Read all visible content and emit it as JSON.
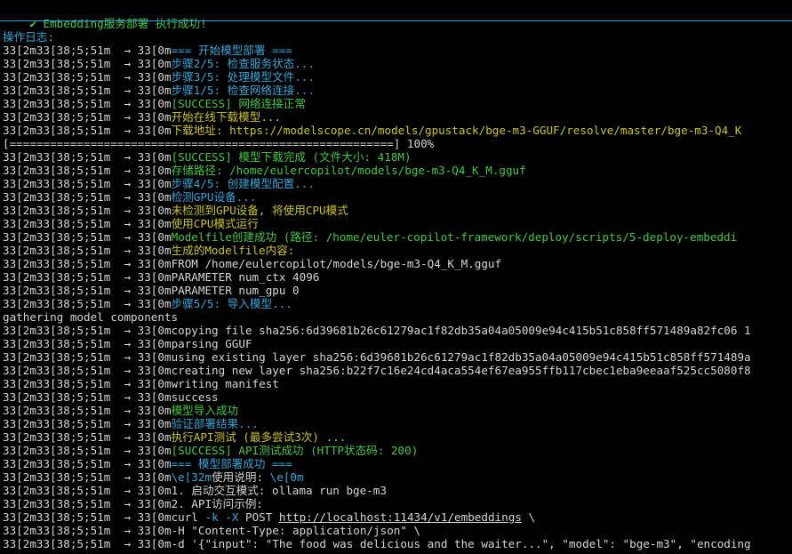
{
  "colors": {
    "background": "#000000",
    "default": "#d6d6d6",
    "cyan": "#3aa4d6",
    "green": "#45c645",
    "yellow": "#c9c432"
  },
  "title": {
    "check_icon": "✔",
    "text": " Embedding服务部署 执行成功!"
  },
  "lines": [
    {
      "segments": [
        {
          "t": "操作日志:",
          "c": "cyan"
        }
      ]
    },
    {
      "segments": [
        {
          "t": "33[2m33[38;5;51m  → 33[0m",
          "c": "default"
        },
        {
          "t": "=== 开始模型部署 ===",
          "c": "cyan"
        }
      ]
    },
    {
      "segments": [
        {
          "t": "33[2m33[38;5;51m  → 33[0m",
          "c": "default"
        },
        {
          "t": "步骤2/5: 检查服务状态...",
          "c": "cyan"
        }
      ]
    },
    {
      "segments": [
        {
          "t": "33[2m33[38;5;51m  → 33[0m",
          "c": "default"
        },
        {
          "t": "步骤3/5: 处理模型文件...",
          "c": "cyan"
        }
      ]
    },
    {
      "segments": [
        {
          "t": "33[2m33[38;5;51m  → 33[0m",
          "c": "default"
        },
        {
          "t": "步骤1/5: 检查网络连接...",
          "c": "cyan"
        }
      ]
    },
    {
      "segments": [
        {
          "t": "33[2m33[38;5;51m  → 33[0m",
          "c": "default"
        },
        {
          "t": "[SUCCESS] 网络连接正常",
          "c": "green"
        }
      ]
    },
    {
      "segments": [
        {
          "t": "33[2m33[38;5;51m  → 33[0m",
          "c": "default"
        },
        {
          "t": "开始在线下载模型...",
          "c": "yellow"
        }
      ]
    },
    {
      "segments": [
        {
          "t": "33[2m33[38;5;51m  → 33[0m",
          "c": "default"
        },
        {
          "t": "下载地址: https://modelscope.cn/models/gpustack/bge-m3-GGUF/resolve/master/bge-m3-Q4_K",
          "c": "yellow"
        }
      ]
    },
    {
      "segments": [
        {
          "t": "[=========================================================] 100%",
          "c": "default"
        }
      ]
    },
    {
      "segments": [
        {
          "t": "33[2m33[38;5;51m  → 33[0m",
          "c": "default"
        },
        {
          "t": "[SUCCESS] 模型下载完成 (文件大小: 418M)",
          "c": "green"
        }
      ]
    },
    {
      "segments": [
        {
          "t": "33[2m33[38;5;51m  → 33[0m",
          "c": "default"
        },
        {
          "t": "存储路径: /home/eulercopilot/models/bge-m3-Q4_K_M.gguf",
          "c": "green"
        }
      ]
    },
    {
      "segments": [
        {
          "t": "33[2m33[38;5;51m  → 33[0m",
          "c": "default"
        },
        {
          "t": "步骤4/5: 创建模型配置...",
          "c": "cyan"
        }
      ]
    },
    {
      "segments": [
        {
          "t": "33[2m33[38;5;51m  → 33[0m",
          "c": "default"
        },
        {
          "t": "检测GPU设备...",
          "c": "cyan"
        }
      ]
    },
    {
      "segments": [
        {
          "t": "33[2m33[38;5;51m  → 33[0m",
          "c": "default"
        },
        {
          "t": "未检测到GPU设备, 将使用CPU模式",
          "c": "yellow"
        }
      ]
    },
    {
      "segments": [
        {
          "t": "33[2m33[38;5;51m  → 33[0m",
          "c": "default"
        },
        {
          "t": "使用CPU模式运行",
          "c": "yellow"
        }
      ]
    },
    {
      "segments": [
        {
          "t": "33[2m33[38;5;51m  → 33[0m",
          "c": "default"
        },
        {
          "t": "Modelfile创建成功 (路径: /home/euler-copilot-framework/deploy/scripts/5-deploy-embeddi",
          "c": "green"
        }
      ]
    },
    {
      "segments": [
        {
          "t": "33[2m33[38;5;51m  → 33[0m",
          "c": "default"
        },
        {
          "t": "生成的Modelfile内容:",
          "c": "yellow"
        }
      ]
    },
    {
      "segments": [
        {
          "t": "33[2m33[38;5;51m  → 33[0m",
          "c": "default"
        },
        {
          "t": "FROM /home/eulercopilot/models/bge-m3-Q4_K_M.gguf",
          "c": "default"
        }
      ]
    },
    {
      "segments": [
        {
          "t": "33[2m33[38;5;51m  → 33[0m",
          "c": "default"
        },
        {
          "t": "PARAMETER num_ctx 4096",
          "c": "default"
        }
      ]
    },
    {
      "segments": [
        {
          "t": "33[2m33[38;5;51m  → 33[0m",
          "c": "default"
        },
        {
          "t": "PARAMETER num_gpu 0",
          "c": "default"
        }
      ]
    },
    {
      "segments": [
        {
          "t": "33[2m33[38;5;51m  → 33[0m",
          "c": "default"
        },
        {
          "t": "步骤5/5: 导入模型...",
          "c": "cyan"
        }
      ]
    },
    {
      "segments": [
        {
          "t": "gathering model components",
          "c": "default"
        }
      ]
    },
    {
      "segments": [
        {
          "t": "33[2m33[38;5;51m  → 33[0m",
          "c": "default"
        },
        {
          "t": "copying file sha256:6d39681b26c61279ac1f82db35a04a05009e94c415b51c858ff571489a82fc06 1",
          "c": "default"
        }
      ]
    },
    {
      "segments": [
        {
          "t": "33[2m33[38;5;51m  → 33[0m",
          "c": "default"
        },
        {
          "t": "parsing GGUF",
          "c": "default"
        }
      ]
    },
    {
      "segments": [
        {
          "t": "33[2m33[38;5;51m  → 33[0m",
          "c": "default"
        },
        {
          "t": "using existing layer sha256:6d39681b26c61279ac1f82db35a04a05009e94c415b51c858ff571489a",
          "c": "default"
        }
      ]
    },
    {
      "segments": [
        {
          "t": "33[2m33[38;5;51m  → 33[0m",
          "c": "default"
        },
        {
          "t": "creating new layer sha256:b22f7c16e24cd4aca554ef67ea955ffb117cbec1eba9eeaaf525cc5080f8",
          "c": "default"
        }
      ]
    },
    {
      "segments": [
        {
          "t": "33[2m33[38;5;51m  → 33[0m",
          "c": "default"
        },
        {
          "t": "writing manifest",
          "c": "default"
        }
      ]
    },
    {
      "segments": [
        {
          "t": "33[2m33[38;5;51m  → 33[0m",
          "c": "default"
        },
        {
          "t": "success",
          "c": "default"
        }
      ]
    },
    {
      "segments": [
        {
          "t": "33[2m33[38;5;51m  → 33[0m",
          "c": "default"
        },
        {
          "t": "模型导入成功",
          "c": "green"
        }
      ]
    },
    {
      "segments": [
        {
          "t": "33[2m33[38;5;51m  → 33[0m",
          "c": "default"
        },
        {
          "t": "验证部署结果...",
          "c": "cyan"
        }
      ]
    },
    {
      "segments": [
        {
          "t": "33[2m33[38;5;51m  → 33[0m",
          "c": "default"
        },
        {
          "t": "执行API测试 (最多尝试3次) ...",
          "c": "yellow"
        }
      ]
    },
    {
      "segments": [
        {
          "t": "33[2m33[38;5;51m  → 33[0m",
          "c": "default"
        },
        {
          "t": "[SUCCESS] API测试成功 (HTTP状态码: 200)",
          "c": "green"
        }
      ]
    },
    {
      "segments": [
        {
          "t": "33[2m33[38;5;51m  → 33[0m",
          "c": "default"
        },
        {
          "t": "=== 模型部署成功 ===",
          "c": "cyan"
        }
      ]
    },
    {
      "segments": [
        {
          "t": "33[2m33[38;5;51m  → 33[0m",
          "c": "default"
        },
        {
          "t": "\\e[32m",
          "c": "cyan"
        },
        {
          "t": "使用说明: ",
          "c": "default"
        },
        {
          "t": "\\e[0m",
          "c": "cyan"
        }
      ]
    },
    {
      "segments": [
        {
          "t": "33[2m33[38;5;51m  → 33[0m",
          "c": "default"
        },
        {
          "t": "1. 启动交互模式: ollama run bge-m3",
          "c": "default"
        }
      ]
    },
    {
      "segments": [
        {
          "t": "33[2m33[38;5;51m  → 33[0m",
          "c": "default"
        },
        {
          "t": "2. API访问示例:",
          "c": "default"
        }
      ]
    },
    {
      "segments": [
        {
          "t": "33[2m33[38;5;51m  → 33[0m",
          "c": "default"
        },
        {
          "t": "curl ",
          "c": "default"
        },
        {
          "t": "-k -X",
          "c": "cyan"
        },
        {
          "t": " POST ",
          "c": "default"
        },
        {
          "t": "http://localhost:11434/v1/embeddings",
          "c": "default",
          "u": true
        },
        {
          "t": " \\",
          "c": "default"
        }
      ]
    },
    {
      "segments": [
        {
          "t": "33[2m33[38;5;51m  → 33[0m",
          "c": "default"
        },
        {
          "t": "-H \"Content-Type: application/json\" \\",
          "c": "default"
        }
      ]
    },
    {
      "segments": [
        {
          "t": "33[2m33[38;5;51m  → 33[0m",
          "c": "default"
        },
        {
          "t": "-d '{\"input\": \"The food was delicious and the waiter...\", \"model\": \"bge-m3\", \"encoding",
          "c": "default"
        }
      ]
    }
  ]
}
